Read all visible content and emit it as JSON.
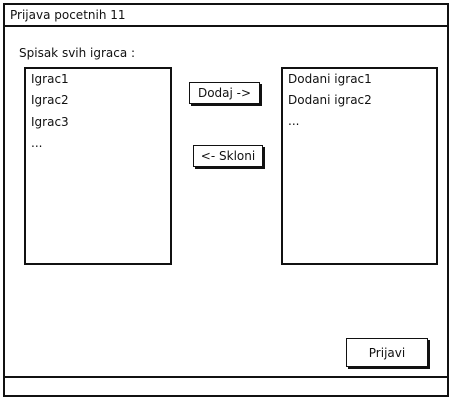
{
  "window": {
    "title": "Prijava pocetnih 11"
  },
  "main": {
    "list_caption": "Spisak svih igraca :",
    "all_players": [
      {
        "label": "Igrac1"
      },
      {
        "label": "Igrac2"
      },
      {
        "label": "Igrac3"
      },
      {
        "label": "..."
      }
    ],
    "selected_players": [
      {
        "label": "Dodani igrac1"
      },
      {
        "label": "Dodani igrac2"
      },
      {
        "label": "..."
      }
    ],
    "buttons": {
      "add_label": "Dodaj ->",
      "remove_label": "<- Skloni",
      "submit_label": "Prijavi"
    }
  }
}
